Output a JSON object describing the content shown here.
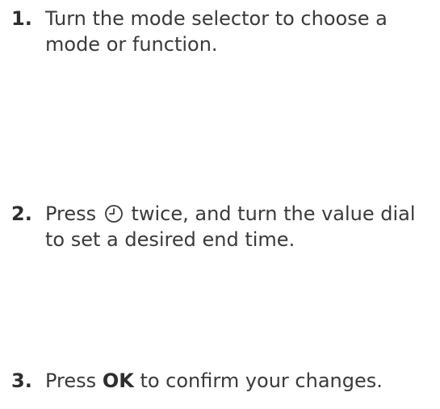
{
  "steps": [
    {
      "number": "1.",
      "text": "Turn the mode selector to choose a mode or function."
    },
    {
      "number": "2.",
      "text_before_icon": "Press",
      "icon": "clock-icon",
      "text_after_icon": "twice, and turn the value dial to set a desired end time."
    },
    {
      "number": "3.",
      "text_before_bold": "Press",
      "bold": "OK",
      "text_after_bold": "to confirm your changes."
    }
  ]
}
